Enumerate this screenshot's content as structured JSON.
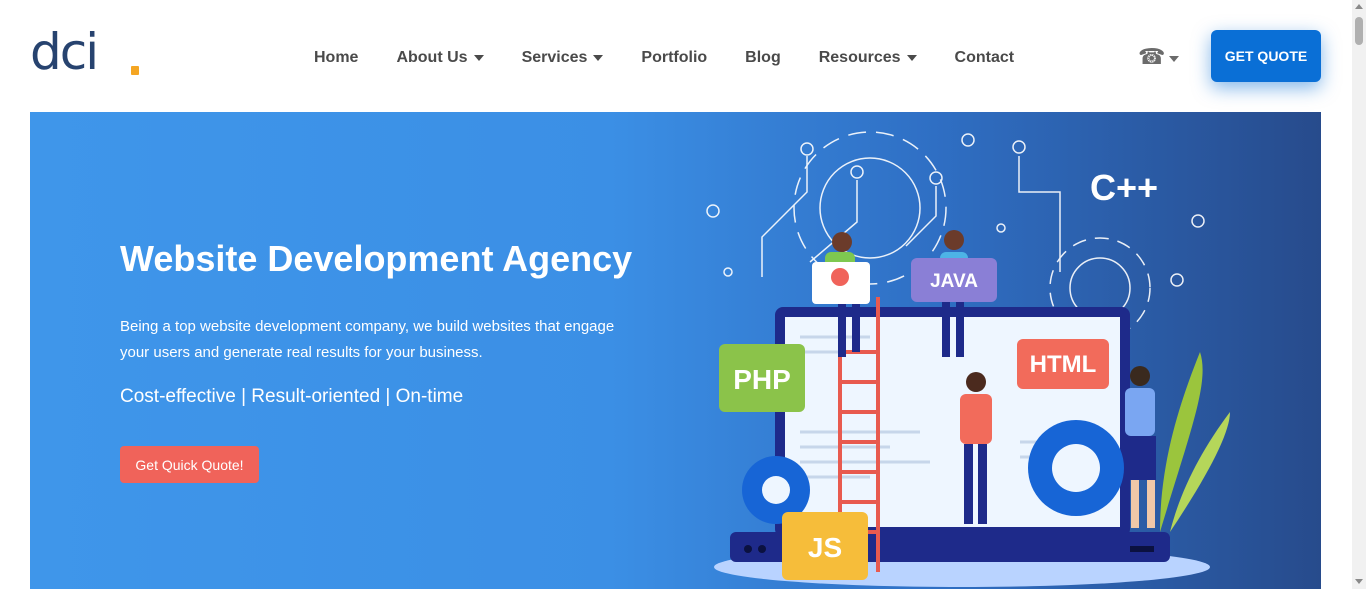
{
  "logo": {
    "text": "dc",
    "text_i": "i",
    "dot_color": "#f5a623"
  },
  "nav": [
    {
      "label": "Home",
      "dropdown": false
    },
    {
      "label": "About Us",
      "dropdown": true
    },
    {
      "label": "Services",
      "dropdown": true
    },
    {
      "label": "Portfolio",
      "dropdown": false
    },
    {
      "label": "Blog",
      "dropdown": false
    },
    {
      "label": "Resources",
      "dropdown": true
    },
    {
      "label": "Contact",
      "dropdown": false
    }
  ],
  "phone": {
    "icon": "☎"
  },
  "header_cta": {
    "label": "GET QUOTE",
    "color": "#0a6fd6"
  },
  "hero": {
    "title": "Website Development Agency",
    "description": "Being a top website development company, we build websites that engage your users and generate real results for your business.",
    "tagline": "Cost-effective | Result-oriented | On-time",
    "cta_label": "Get Quick Quote!",
    "cta_color": "#f0635a"
  },
  "illustration": {
    "labels": {
      "cpp": "C++",
      "java": "JAVA",
      "php": "PHP",
      "html": "HTML",
      "js": "JS"
    }
  }
}
